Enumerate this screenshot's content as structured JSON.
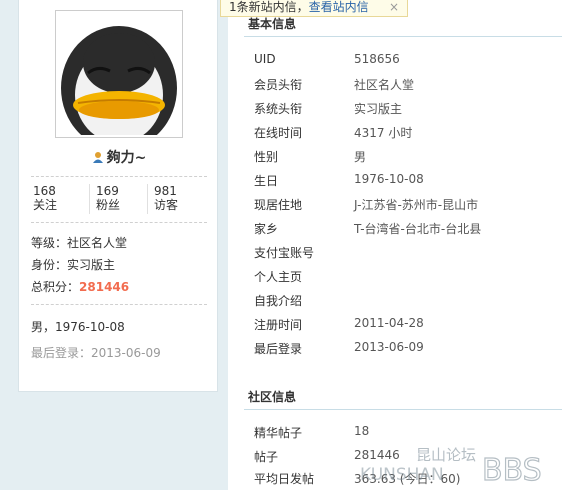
{
  "notice": {
    "text": "1条新站内信，",
    "link": "查看站内信",
    "close": "×"
  },
  "profile": {
    "username": "夠力~",
    "stats": [
      {
        "value": "168",
        "label": "关注"
      },
      {
        "value": "169",
        "label": "粉丝"
      },
      {
        "value": "981",
        "label": "访客"
      }
    ],
    "level_label": "等级：",
    "level": "社区名人堂",
    "identity_label": "身份：",
    "identity": "实习版主",
    "score_label": "总积分：",
    "score": "281446",
    "gender_birthday": "男，1976-10-08",
    "last_login": "最后登录：2013-06-09"
  },
  "basic": {
    "title": "基本信息",
    "rows": [
      {
        "k": "UID",
        "v": "518656"
      },
      {
        "k": "会员头衔",
        "v": "社区名人堂"
      },
      {
        "k": "系统头衔",
        "v": "实习版主"
      },
      {
        "k": "在线时间",
        "v": "4317 小时"
      },
      {
        "k": "性别",
        "v": "男"
      },
      {
        "k": "生日",
        "v": "1976-10-08"
      },
      {
        "k": "现居住地",
        "v": "J-江苏省-苏州市-昆山市"
      },
      {
        "k": "家乡",
        "v": "T-台湾省-台北市-台北县"
      },
      {
        "k": "支付宝账号",
        "v": ""
      },
      {
        "k": "个人主页",
        "v": ""
      },
      {
        "k": "自我介绍",
        "v": ""
      },
      {
        "k": "注册时间",
        "v": "2011-04-28"
      },
      {
        "k": "最后登录",
        "v": "2013-06-09"
      }
    ]
  },
  "community": {
    "title": "社区信息",
    "rows": [
      {
        "k": "精华帖子",
        "v": "18"
      },
      {
        "k": "帖子",
        "v": "281446"
      },
      {
        "k": "平均日发帖",
        "v": "363.63 (今日：60)"
      }
    ]
  },
  "watermark": {
    "cn": "昆山论坛",
    "en": "KUNSHAN",
    "bbs": "BBS"
  },
  "colors": {
    "accent_score": "#f26c4f",
    "link": "#2a64a8",
    "page_bg": "#e4eef2"
  }
}
